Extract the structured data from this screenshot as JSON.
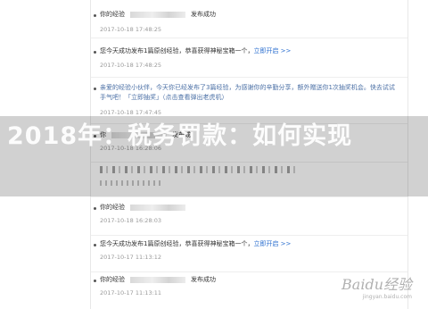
{
  "feed": {
    "items": [
      {
        "pre": "你的经验",
        "post": "发布成功",
        "time": "2017-10-18 17:48:25"
      },
      {
        "text": "您今天成功发布1篇原创经验，恭喜获得神秘宝箱一个，",
        "link": "立即开启 >>",
        "time": "2017-10-18 17:48:25"
      },
      {
        "text": "亲爱的经验小伙伴，今天你已经发布了3篇经验，为感谢你的辛勤分享，额外赠送你1次抽奖机会。快去试试手气吧！「立即抽奖」（点击查看弹出老虎机）",
        "time": "2017-10-18 17:47:45"
      },
      {
        "pre": "你",
        "post": "发布成",
        "time": "2017-10-18 16:28:06"
      },
      {
        "pre": "你的经验",
        "post": "",
        "time": "2017-10-18 16:28:03"
      },
      {
        "text": "您今天成功发布1篇原创经验，恭喜获得神秘宝箱一个，",
        "link": "立即开启 >>",
        "time": "2017-10-17 11:13:12"
      },
      {
        "pre": "你的经验",
        "post": "发布成功",
        "time": "2017-10-17 11:13:11"
      }
    ]
  },
  "overlay": {
    "headline": "2018年：税务罚款：如何实现"
  },
  "watermark": {
    "brand": "Baidu经验",
    "url": "jingyan.baidu.com"
  }
}
